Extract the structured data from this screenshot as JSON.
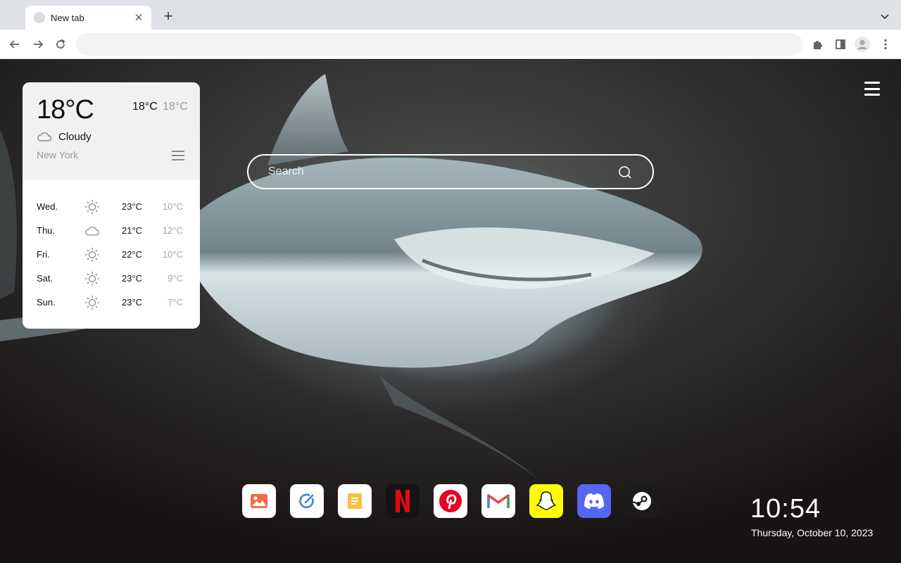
{
  "browser": {
    "tab_title": "New tab",
    "tab_close": "✕",
    "new_tab": "+",
    "omnibox_value": ""
  },
  "search": {
    "placeholder": "Search"
  },
  "weather": {
    "current_temp": "18°C",
    "high": "18°C",
    "low": "18°C",
    "condition": "Cloudy",
    "condition_icon": "cloud-icon",
    "city": "New York",
    "forecast": [
      {
        "day": "Wed.",
        "icon": "sun-icon",
        "high": "23°C",
        "low": "10°C"
      },
      {
        "day": "Thu.",
        "icon": "cloud-icon",
        "high": "21°C",
        "low": "12°C"
      },
      {
        "day": "Fri.",
        "icon": "sun-icon",
        "high": "22°C",
        "low": "10°C"
      },
      {
        "day": "Sat.",
        "icon": "sun-icon",
        "high": "23°C",
        "low": "9°C"
      },
      {
        "day": "Sun.",
        "icon": "sun-icon",
        "high": "23°C",
        "low": "7°C"
      }
    ]
  },
  "dock": [
    {
      "name": "photos-app",
      "bg": "#ffffff"
    },
    {
      "name": "edit-app",
      "bg": "#ffffff"
    },
    {
      "name": "notes-app",
      "bg": "#ffffff"
    },
    {
      "name": "netflix-app",
      "bg": "#141414"
    },
    {
      "name": "pinterest-app",
      "bg": "#ffffff"
    },
    {
      "name": "gmail-app",
      "bg": "#ffffff"
    },
    {
      "name": "snapchat-app",
      "bg": "#fffc00"
    },
    {
      "name": "discord-app",
      "bg": "#5865f2"
    },
    {
      "name": "steam-app",
      "bg": "#1b1b1d"
    }
  ],
  "clock": {
    "time": "10:54",
    "date": "Thursday, October 10, 2023"
  },
  "colors": {
    "tabstrip": "#dee1e6",
    "netflix_red": "#e50914",
    "pinterest_red": "#e60023",
    "discord": "#5865f2",
    "snapchat": "#fffc00"
  }
}
